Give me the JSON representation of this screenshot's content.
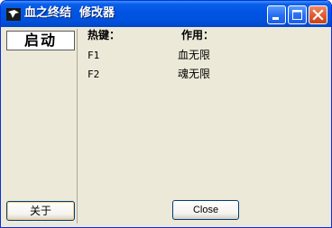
{
  "window": {
    "title": "血之终结  修改器"
  },
  "sidebar": {
    "start_label": "启动",
    "about_label": "关于"
  },
  "hotkeys": {
    "header_key": "热键：",
    "header_effect": "作用：",
    "rows": [
      {
        "key": "F1",
        "effect": "血无限"
      },
      {
        "key": "F2",
        "effect": "魂无限"
      }
    ]
  },
  "footer": {
    "close_label": "Close"
  },
  "colors": {
    "titlebar": "#0054e3",
    "window_bg": "#ece9d8",
    "close_button_red": "#e25c32"
  }
}
